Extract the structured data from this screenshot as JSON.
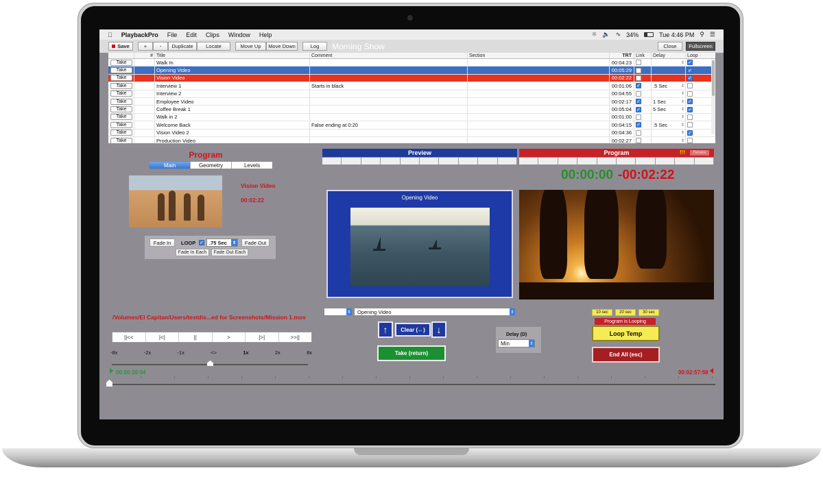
{
  "menubar": {
    "apple": "",
    "app": "PlaybackPro",
    "items": [
      "File",
      "Edit",
      "Clips",
      "Window",
      "Help"
    ],
    "battery": "34%",
    "time": "Tue 4:46 PM"
  },
  "toolbar": {
    "save": "Save",
    "plus": "+",
    "minus": "-",
    "duplicate": "Duplicate",
    "locate": "Locate",
    "move_up": "Move Up",
    "move_down": "Move Down",
    "log": "Log",
    "show_title": "Morning Show",
    "close": "Close",
    "fullscreen": "Fullscreen"
  },
  "playlist": {
    "headers": {
      "num": "#",
      "title": "Title",
      "comment": "Comment",
      "section": "Section",
      "trt": "TRT",
      "link": "Link",
      "delay": "Delay",
      "loop": "Loop"
    },
    "take_label": "Take",
    "rows": [
      {
        "title": "Walk In",
        "comment": "",
        "trt": "00:04:23",
        "link": false,
        "delay": "",
        "loop": true,
        "state": ""
      },
      {
        "title": "Opening Video",
        "comment": "",
        "trt": "00:05:29",
        "link": false,
        "delay": "",
        "loop": true,
        "state": "preview"
      },
      {
        "title": "Vision Video",
        "comment": "",
        "trt": "00:02:22",
        "link": false,
        "delay": "",
        "loop": true,
        "state": "program"
      },
      {
        "title": "Interview 1",
        "comment": "Starts in black",
        "trt": "00:01:06",
        "link": true,
        "delay": ".5 Sec",
        "loop": false,
        "state": ""
      },
      {
        "title": "Interview 2",
        "comment": "",
        "trt": "00:04:55",
        "link": false,
        "delay": "",
        "loop": false,
        "state": ""
      },
      {
        "title": "Employee Video",
        "comment": "",
        "trt": "00:02:17",
        "link": true,
        "delay": "1 Sec",
        "loop": true,
        "state": ""
      },
      {
        "title": "Coffee Break 1",
        "comment": "",
        "trt": "00:05:04",
        "link": true,
        "delay": "5 Sec",
        "loop": true,
        "state": ""
      },
      {
        "title": "Walk in 2",
        "comment": "",
        "trt": "00:01:00",
        "link": false,
        "delay": "",
        "loop": false,
        "state": ""
      },
      {
        "title": "Welcome Back",
        "comment": "False ending at 0:20",
        "trt": "00:04:15",
        "link": true,
        "delay": ".5 Sec",
        "loop": false,
        "state": ""
      },
      {
        "title": "Vision Video 2",
        "comment": "",
        "trt": "00:04:36",
        "link": false,
        "delay": "",
        "loop": true,
        "state": ""
      },
      {
        "title": "Production Video",
        "comment": "",
        "trt": "00:02:27",
        "link": false,
        "delay": "",
        "loop": false,
        "state": ""
      }
    ]
  },
  "left": {
    "title": "Program",
    "tabs": [
      "Main",
      "Geometry",
      "Levels"
    ],
    "clip_name": "Vision Video",
    "clip_time": "00:02:22",
    "fade_in": "Fade In",
    "loop": "LOOP",
    "fade_dur": ".75 Sec",
    "fade_out": "Fade Out",
    "fade_in_each": "Fade In Each",
    "fade_out_each": "Fade Out Each",
    "path": "/Volumes/El Capitan/Users/testdis...ed for Screenshots/Mission 1.mov",
    "transport": [
      "||<<",
      "|<|",
      "||",
      ">",
      "|>|",
      ">>||"
    ],
    "speeds": [
      "-8x",
      "-2x",
      "-1x",
      "<>",
      "1x",
      "2x",
      "8x"
    ],
    "speed_level": 0.5
  },
  "preview": {
    "title": "Preview",
    "clip": "Opening Video",
    "selector": "Opening Video",
    "up": "↑",
    "clear": "Clear (←)",
    "down": "↓",
    "take": "Take (return)",
    "delay_label": "Delay (D)",
    "delay_value": "Min"
  },
  "program": {
    "title": "Program",
    "excl": "!!!",
    "btn": "Retake",
    "elapsed": "00:00:00",
    "remaining": "-00:02:22",
    "sec_btns": [
      "10 sec",
      "20 sec",
      "30 sec"
    ],
    "looping": "Program is Looping",
    "loop_temp": "Loop Temp",
    "end_all": "End All (esc)"
  },
  "timeline": {
    "start": "00:00:35:04",
    "end": "00:02:57:58",
    "position": 0.0
  }
}
